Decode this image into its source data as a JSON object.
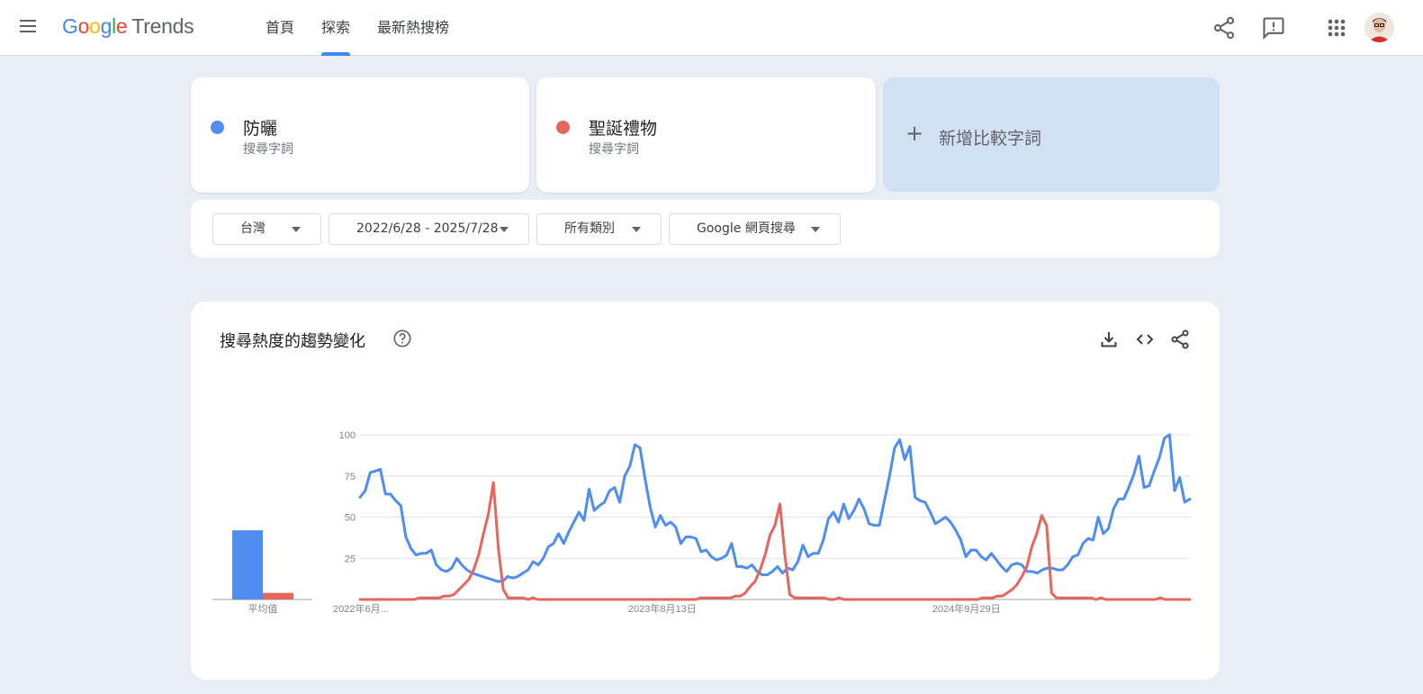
{
  "header": {
    "logo_parts": [
      "G",
      "o",
      "o",
      "g",
      "l",
      "e"
    ],
    "logo_suffix": "Trends",
    "tabs": [
      {
        "label": "首頁"
      },
      {
        "label": "探索",
        "active": true
      },
      {
        "label": "最新熱搜榜"
      }
    ],
    "icons": [
      "menu-icon",
      "share-icon",
      "feedback-icon",
      "apps-icon",
      "avatar"
    ]
  },
  "terms": [
    {
      "label": "防曬",
      "sub": "搜尋字詞",
      "color": "#4f8ef0"
    },
    {
      "label": "聖誕禮物",
      "sub": "搜尋字詞",
      "color": "#e5665c"
    }
  ],
  "add_compare": {
    "icon": "+",
    "label": "新增比較字詞"
  },
  "filters": {
    "region": "台灣",
    "date_range": "2022/6/28 - 2025/7/28",
    "category": "所有類別",
    "search_type": "Google 網頁搜尋"
  },
  "chart_section": {
    "title": "搜尋熱度的趨勢變化",
    "icons": [
      "help-icon",
      "download-icon",
      "embed-icon",
      "share-icon"
    ]
  },
  "chart_data": {
    "type": "line",
    "title": "搜尋熱度的趨勢變化",
    "ylim": [
      0,
      100
    ],
    "yticks": [
      25,
      50,
      75,
      100
    ],
    "grid": true,
    "xtick_labels": [
      "2022年6月...",
      "2023年8月13日",
      "2024年9月29日"
    ],
    "x_range": [
      "2022-06-26",
      "2025-07-27"
    ],
    "average_label": "平均值",
    "averages": [
      {
        "name": "防曬",
        "value": 42
      },
      {
        "name": "聖誕禮物",
        "value": 4
      }
    ],
    "series": [
      {
        "name": "防曬",
        "color": "#4f8ef0",
        "values": [
          62,
          66,
          77,
          78,
          79,
          64,
          64,
          60,
          57,
          38,
          31,
          27,
          28,
          28,
          30,
          21,
          18,
          17,
          19,
          25,
          21,
          18,
          16,
          15,
          14,
          13,
          12,
          11,
          11,
          14,
          13,
          14,
          16,
          18,
          23,
          21,
          25,
          32,
          34,
          40,
          34,
          41,
          47,
          53,
          48,
          67,
          54,
          57,
          59,
          66,
          68,
          59,
          75,
          81,
          94,
          92,
          73,
          56,
          44,
          51,
          45,
          47,
          44,
          34,
          38,
          38,
          37,
          29,
          30,
          26,
          24,
          25,
          27,
          34,
          20,
          20,
          19,
          21,
          17,
          15,
          15,
          17,
          20,
          16,
          19,
          18,
          23,
          33,
          26,
          28,
          28,
          36,
          49,
          53,
          47,
          58,
          49,
          54,
          61,
          55,
          46,
          45,
          45,
          60,
          75,
          92,
          97,
          85,
          93,
          62,
          60,
          59,
          53,
          46,
          48,
          50,
          47,
          42,
          36,
          26,
          30,
          30,
          26,
          24,
          28,
          24,
          20,
          17,
          21,
          22,
          21,
          17,
          17,
          16,
          18,
          19,
          19,
          18,
          18,
          21,
          26,
          27,
          34,
          37,
          36,
          50,
          40,
          43,
          55,
          61,
          61,
          68,
          76,
          87,
          68,
          69,
          78,
          86,
          98,
          100,
          66,
          74,
          59,
          61
        ]
      },
      {
        "name": "聖誕禮物",
        "color": "#e5665c",
        "values": [
          0,
          0,
          0,
          0,
          0,
          0,
          0,
          0,
          0,
          0,
          0,
          0,
          1,
          1,
          1,
          1,
          1,
          2,
          2,
          3,
          6,
          9,
          12,
          18,
          27,
          40,
          52,
          71,
          31,
          6,
          1,
          1,
          1,
          1,
          0,
          1,
          0,
          0,
          0,
          0,
          0,
          0,
          0,
          0,
          0,
          0,
          0,
          0,
          0,
          0,
          0,
          0,
          0,
          0,
          0,
          0,
          0,
          0,
          0,
          0,
          0,
          0,
          0,
          0,
          0,
          0,
          0,
          0,
          0,
          1,
          1,
          1,
          1,
          1,
          1,
          1,
          2,
          2,
          4,
          8,
          11,
          18,
          27,
          39,
          45,
          58,
          27,
          3,
          1,
          1,
          1,
          1,
          1,
          1,
          1,
          0,
          0,
          1,
          0,
          0,
          0,
          0,
          0,
          0,
          0,
          0,
          0,
          0,
          0,
          0,
          0,
          0,
          0,
          0,
          0,
          0,
          0,
          0,
          0,
          0,
          0,
          0,
          0,
          0,
          0,
          0,
          1,
          1,
          1,
          2,
          2,
          4,
          6,
          9,
          14,
          20,
          32,
          40,
          51,
          45,
          4,
          1,
          1,
          1,
          1,
          1,
          1,
          1,
          1,
          0,
          1,
          0,
          0,
          0,
          0,
          0,
          0,
          0,
          0,
          0,
          0,
          0,
          1,
          0,
          0,
          0,
          0,
          0,
          0
        ]
      }
    ]
  }
}
